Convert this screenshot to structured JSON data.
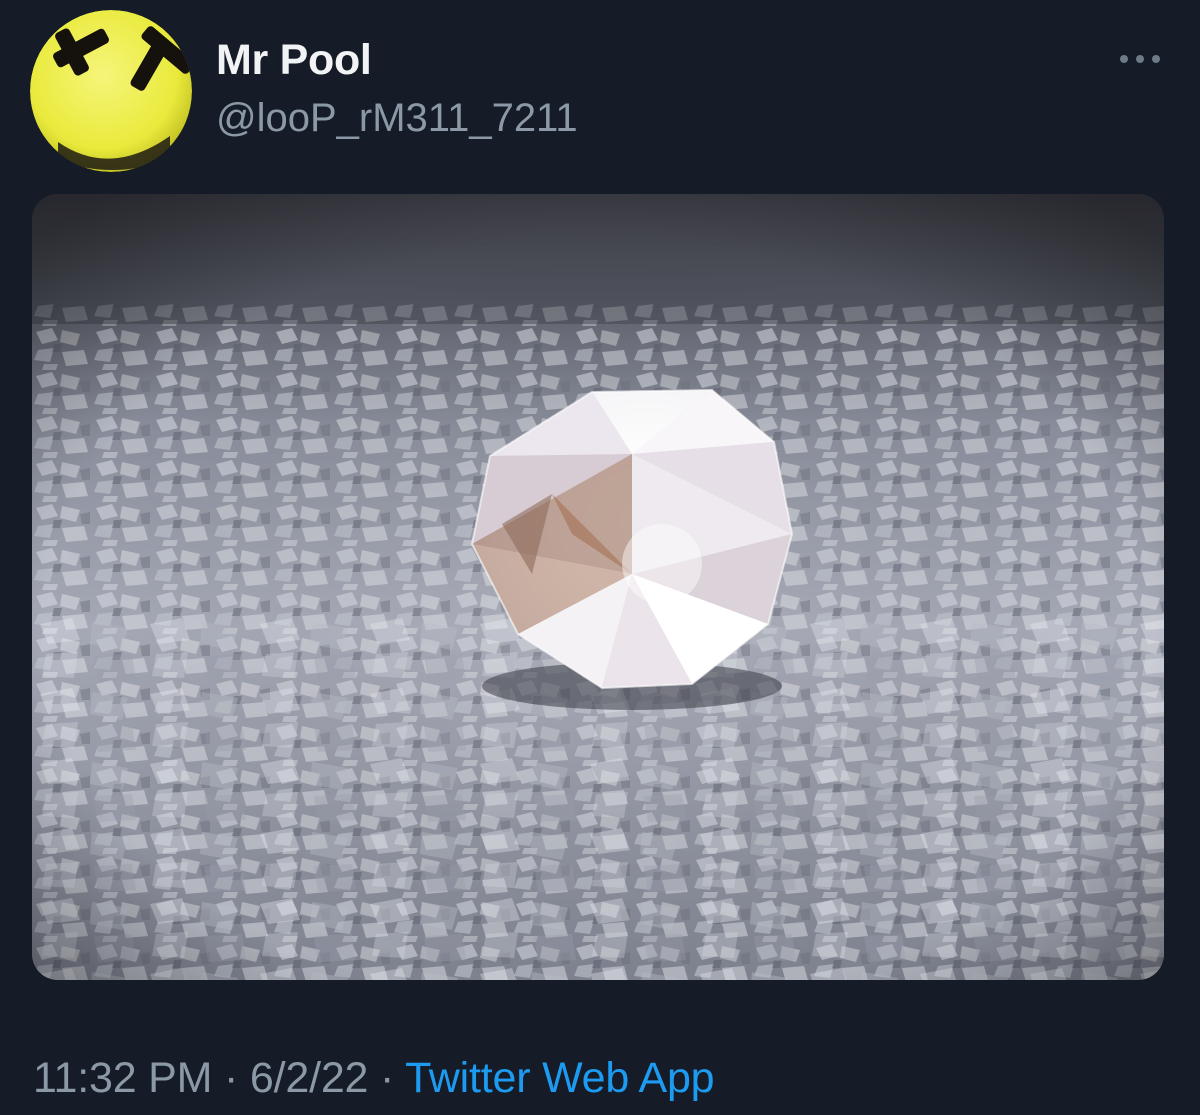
{
  "tweet": {
    "author": {
      "display_name": "Mr Pool",
      "handle": "@looP_rM311_7211",
      "avatar_icon": "dead-smiley-face-icon",
      "avatar_color": "#f2f24a"
    },
    "more_icon": "more-dots-icon",
    "media": {
      "kind": "photo"
    },
    "footer": {
      "time": "11:32 PM",
      "separator": " · ",
      "date": "6/2/22",
      "source": "Twitter Web App"
    }
  },
  "theme": {
    "background": "#151b27",
    "secondary_text": "#8b98a5",
    "link": "#1d9bf0"
  }
}
